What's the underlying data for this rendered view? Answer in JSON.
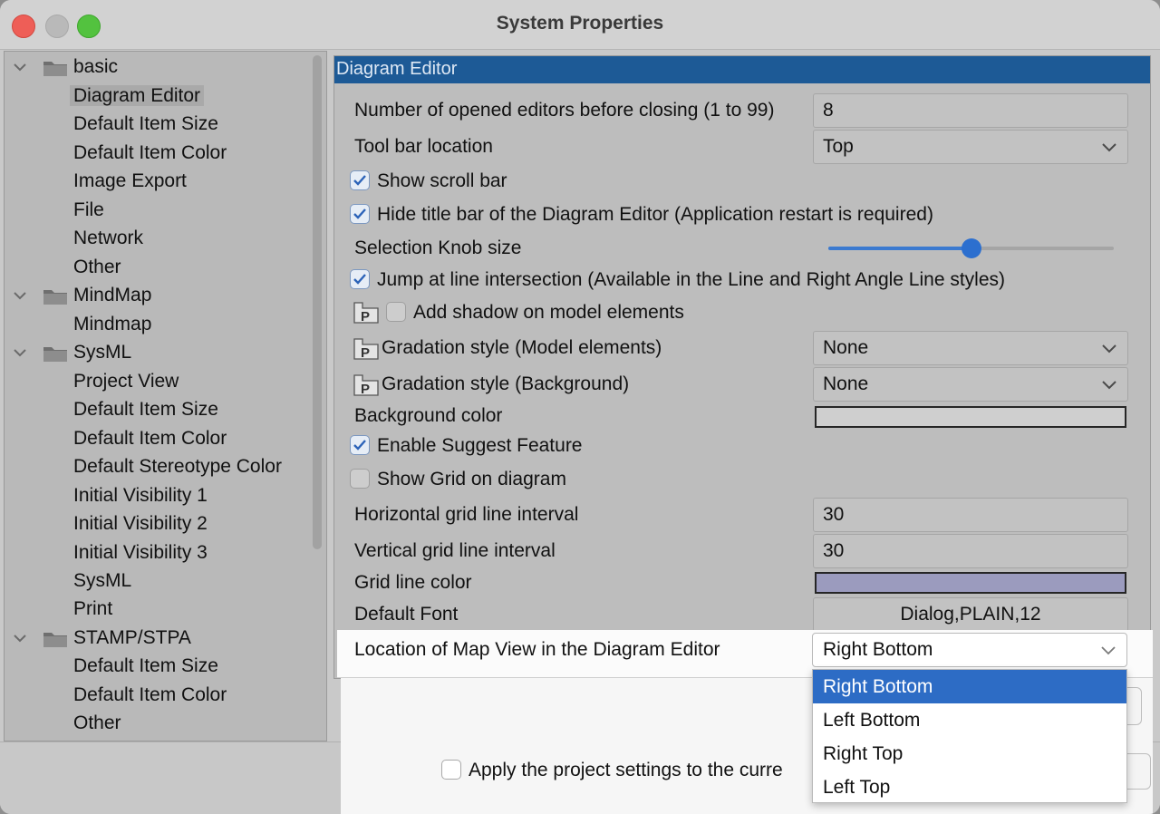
{
  "window": {
    "title": "System Properties"
  },
  "tree": {
    "groups": [
      {
        "label": "basic",
        "items": [
          "Diagram Editor",
          "Default Item Size",
          "Default Item Color",
          "Image Export",
          "File",
          "Network",
          "Other"
        ]
      },
      {
        "label": "MindMap",
        "items": [
          "Mindmap"
        ]
      },
      {
        "label": "SysML",
        "items": [
          "Project View",
          "Default Item Size",
          "Default Item Color",
          "Default Stereotype Color",
          "Initial Visibility 1",
          "Initial Visibility 2",
          "Initial Visibility 3",
          "SysML",
          "Print"
        ]
      },
      {
        "label": "STAMP/STPA",
        "items": [
          "Default Item Size",
          "Default Item Color",
          "Other"
        ]
      }
    ],
    "selected": "Diagram Editor"
  },
  "panel": {
    "header": "Diagram Editor",
    "num_editors_label": "Number of opened editors before closing (1 to 99)",
    "num_editors_value": "8",
    "toolbar_location_label": "Tool bar location",
    "toolbar_location_value": "Top",
    "show_scroll_bar": {
      "label": "Show scroll bar",
      "checked": true
    },
    "hide_title_bar": {
      "label": "Hide title bar of the Diagram Editor (Application restart is required)",
      "checked": true
    },
    "selection_knob_label": "Selection Knob size",
    "selection_knob_level": 0.5,
    "jump_line": {
      "label": "Jump at line intersection (Available in the Line and Right Angle Line styles)",
      "checked": true
    },
    "add_shadow": {
      "label": "Add shadow on model elements",
      "checked": false
    },
    "grad_model_label": "Gradation style (Model elements)",
    "grad_model_value": "None",
    "grad_bg_label": "Gradation style (Background)",
    "grad_bg_value": "None",
    "bg_color_label": "Background color",
    "bg_color": "#cfcfcf",
    "suggest": {
      "label": "Enable Suggest Feature",
      "checked": true
    },
    "show_grid": {
      "label": "Show Grid on diagram",
      "checked": false
    },
    "h_grid_label": "Horizontal grid line interval",
    "h_grid_value": "30",
    "v_grid_label": "Vertical grid line interval",
    "v_grid_value": "30",
    "grid_color_label": "Grid line color",
    "grid_color": "#9b9bbe",
    "font_label": "Default Font",
    "font_value": "Dialog,PLAIN,12",
    "map_view_label": "Location of Map View in the Diagram Editor",
    "map_view_value": "Right Bottom",
    "map_view_options": [
      "Right Bottom",
      "Left Bottom",
      "Right Top",
      "Left Top"
    ]
  },
  "footer": {
    "apply_project": {
      "label": "Apply the project settings to the curre",
      "checked": false
    }
  },
  "colors": {
    "accent": "#2d6cc5",
    "header": "#1d5a96"
  }
}
